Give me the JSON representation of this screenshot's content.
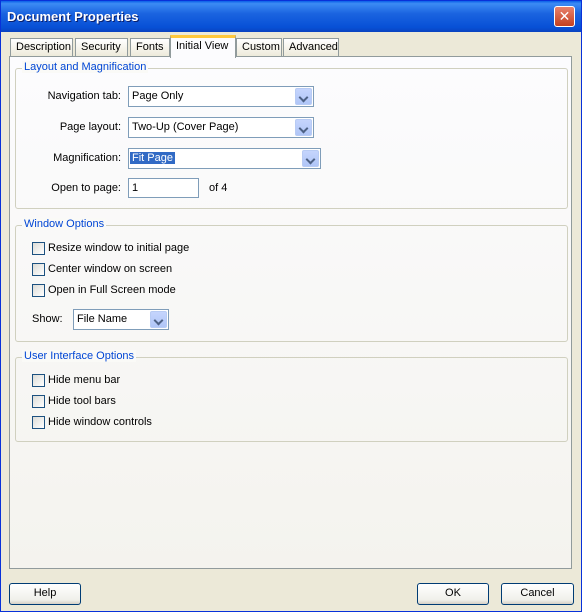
{
  "window": {
    "title": "Document Properties"
  },
  "tabs": [
    {
      "label": "Description"
    },
    {
      "label": "Security"
    },
    {
      "label": "Fonts"
    },
    {
      "label": "Initial View"
    },
    {
      "label": "Custom"
    },
    {
      "label": "Advanced"
    }
  ],
  "active_tab": "Initial View",
  "layout": {
    "legend": "Layout and Magnification",
    "navigation_tab": {
      "label": "Navigation tab:",
      "value": "Page Only"
    },
    "page_layout": {
      "label": "Page layout:",
      "value": "Two-Up (Cover Page)"
    },
    "magnification": {
      "label": "Magnification:",
      "value": "Fit Page"
    },
    "open_to_page": {
      "label": "Open to page:",
      "value": "1",
      "suffix": "of 4"
    }
  },
  "window_options": {
    "legend": "Window Options",
    "checks": [
      {
        "label": "Resize window to initial page",
        "checked": false
      },
      {
        "label": "Center window on screen",
        "checked": false
      },
      {
        "label": "Open in Full Screen mode",
        "checked": false
      }
    ],
    "show": {
      "label": "Show:",
      "value": "File Name"
    }
  },
  "ui_options": {
    "legend": "User Interface Options",
    "checks": [
      {
        "label": "Hide menu bar",
        "checked": false
      },
      {
        "label": "Hide tool bars",
        "checked": false
      },
      {
        "label": "Hide window controls",
        "checked": false
      }
    ]
  },
  "buttons": {
    "help": "Help",
    "ok": "OK",
    "cancel": "Cancel"
  },
  "colors": {
    "title_blue": "#0a5fe8",
    "group_legend": "#0046d5",
    "tab_highlight": "#ffc83c",
    "selection": "#316ac5"
  }
}
